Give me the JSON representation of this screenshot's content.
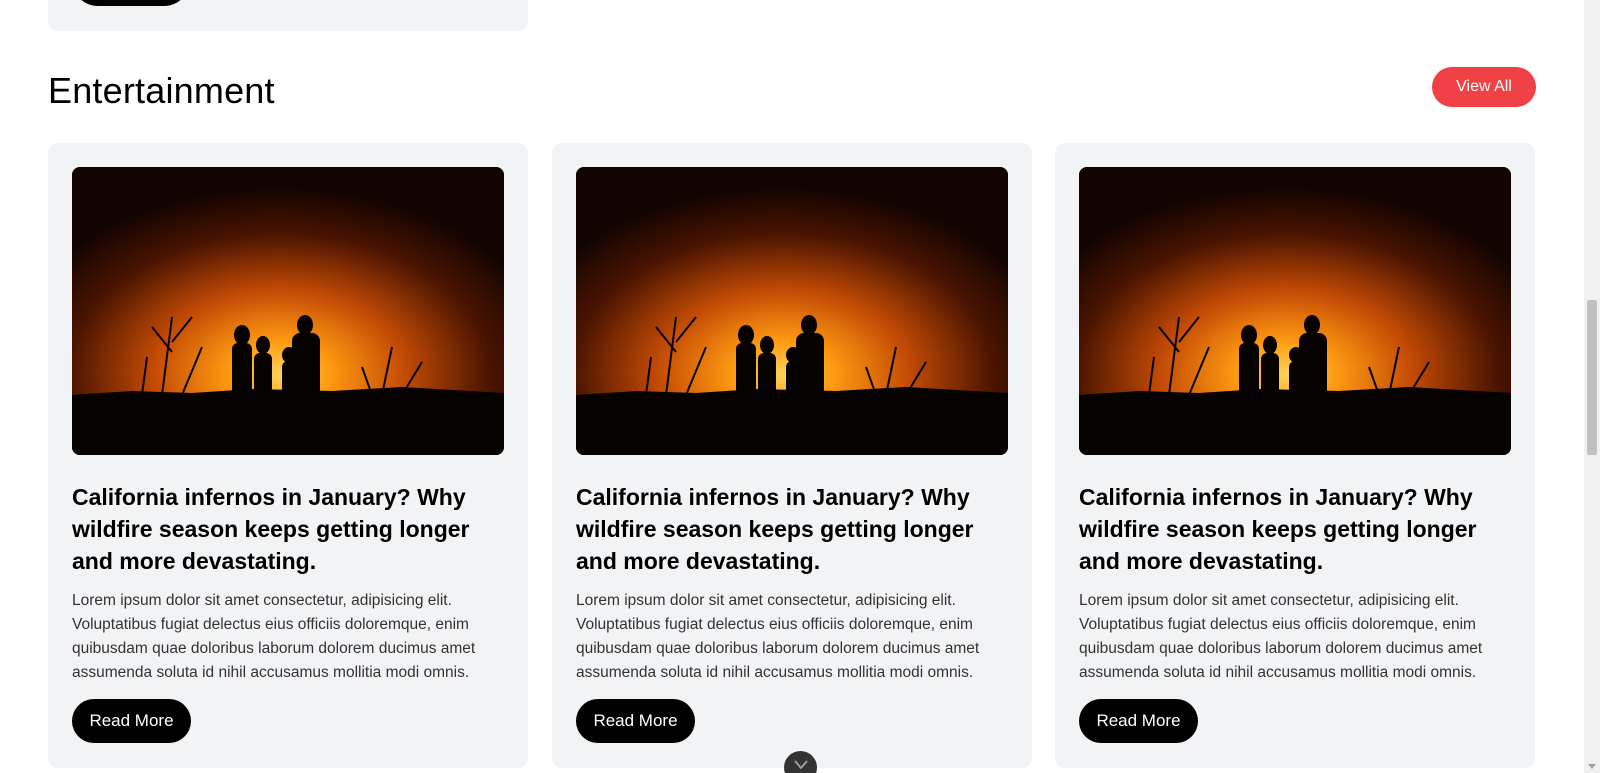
{
  "section": {
    "title": "Entertainment",
    "view_all_label": "View All"
  },
  "cards": [
    {
      "title": "California infernos in January? Why wildfire season keeps getting longer and more devastating.",
      "excerpt": "Lorem ipsum dolor sit amet consectetur, adipisicing elit. Voluptatibus fugiat delectus eius officiis doloremque, enim quibusdam quae doloribus laborum dolorem ducimus amet assumenda soluta id nihil accusamus mollitia modi omnis.",
      "button_label": "Read More"
    },
    {
      "title": "California infernos in January? Why wildfire season keeps getting longer and more devastating.",
      "excerpt": "Lorem ipsum dolor sit amet consectetur, adipisicing elit. Voluptatibus fugiat delectus eius officiis doloremque, enim quibusdam quae doloribus laborum dolorem ducimus amet assumenda soluta id nihil accusamus mollitia modi omnis.",
      "button_label": "Read More"
    },
    {
      "title": "California infernos in January? Why wildfire season keeps getting longer and more devastating.",
      "excerpt": "Lorem ipsum dolor sit amet consectetur, adipisicing elit. Voluptatibus fugiat delectus eius officiis doloremque, enim quibusdam quae doloribus laborum dolorem ducimus amet assumenda soluta id nihil accusamus mollitia modi omnis.",
      "button_label": "Read More"
    }
  ],
  "icons": {
    "scroll_down": "chevron-down-icon"
  },
  "colors": {
    "accent": "#ef4146",
    "card_background": "#f2f3f5",
    "button_dark": "#000000"
  }
}
